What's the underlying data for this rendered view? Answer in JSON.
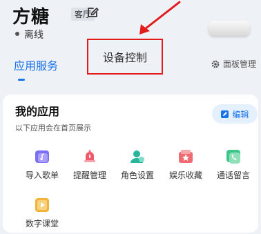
{
  "header": {
    "title": "方糖",
    "room_badge": "客厅",
    "status": "离线"
  },
  "tabs": [
    {
      "label": "应用服务",
      "active": true
    },
    {
      "label": "设备控制",
      "active": false
    }
  ],
  "panel_manage": {
    "label": "面板管理"
  },
  "my_apps": {
    "title": "我的应用",
    "subtitle": "以下应用会在首页展示",
    "edit_label": "编辑",
    "apps": [
      {
        "label": "导入歌单",
        "icon": "music-import-icon",
        "color": "#7b6ef6"
      },
      {
        "label": "提醒管理",
        "icon": "bell-icon",
        "color": "#f25a6b"
      },
      {
        "label": "角色设置",
        "icon": "user-icon",
        "color": "#27b59b"
      },
      {
        "label": "娱乐收藏",
        "icon": "star-folder-icon",
        "color": "#f06a72"
      },
      {
        "label": "通话留言",
        "icon": "phone-message-icon",
        "color": "#3cc68a"
      },
      {
        "label": "数字课堂",
        "icon": "classroom-icon",
        "color": "#f3b23a"
      }
    ]
  },
  "colors": {
    "accent": "#1a73e8",
    "annotation": "#e21b1b",
    "background": "#eef1f6"
  }
}
